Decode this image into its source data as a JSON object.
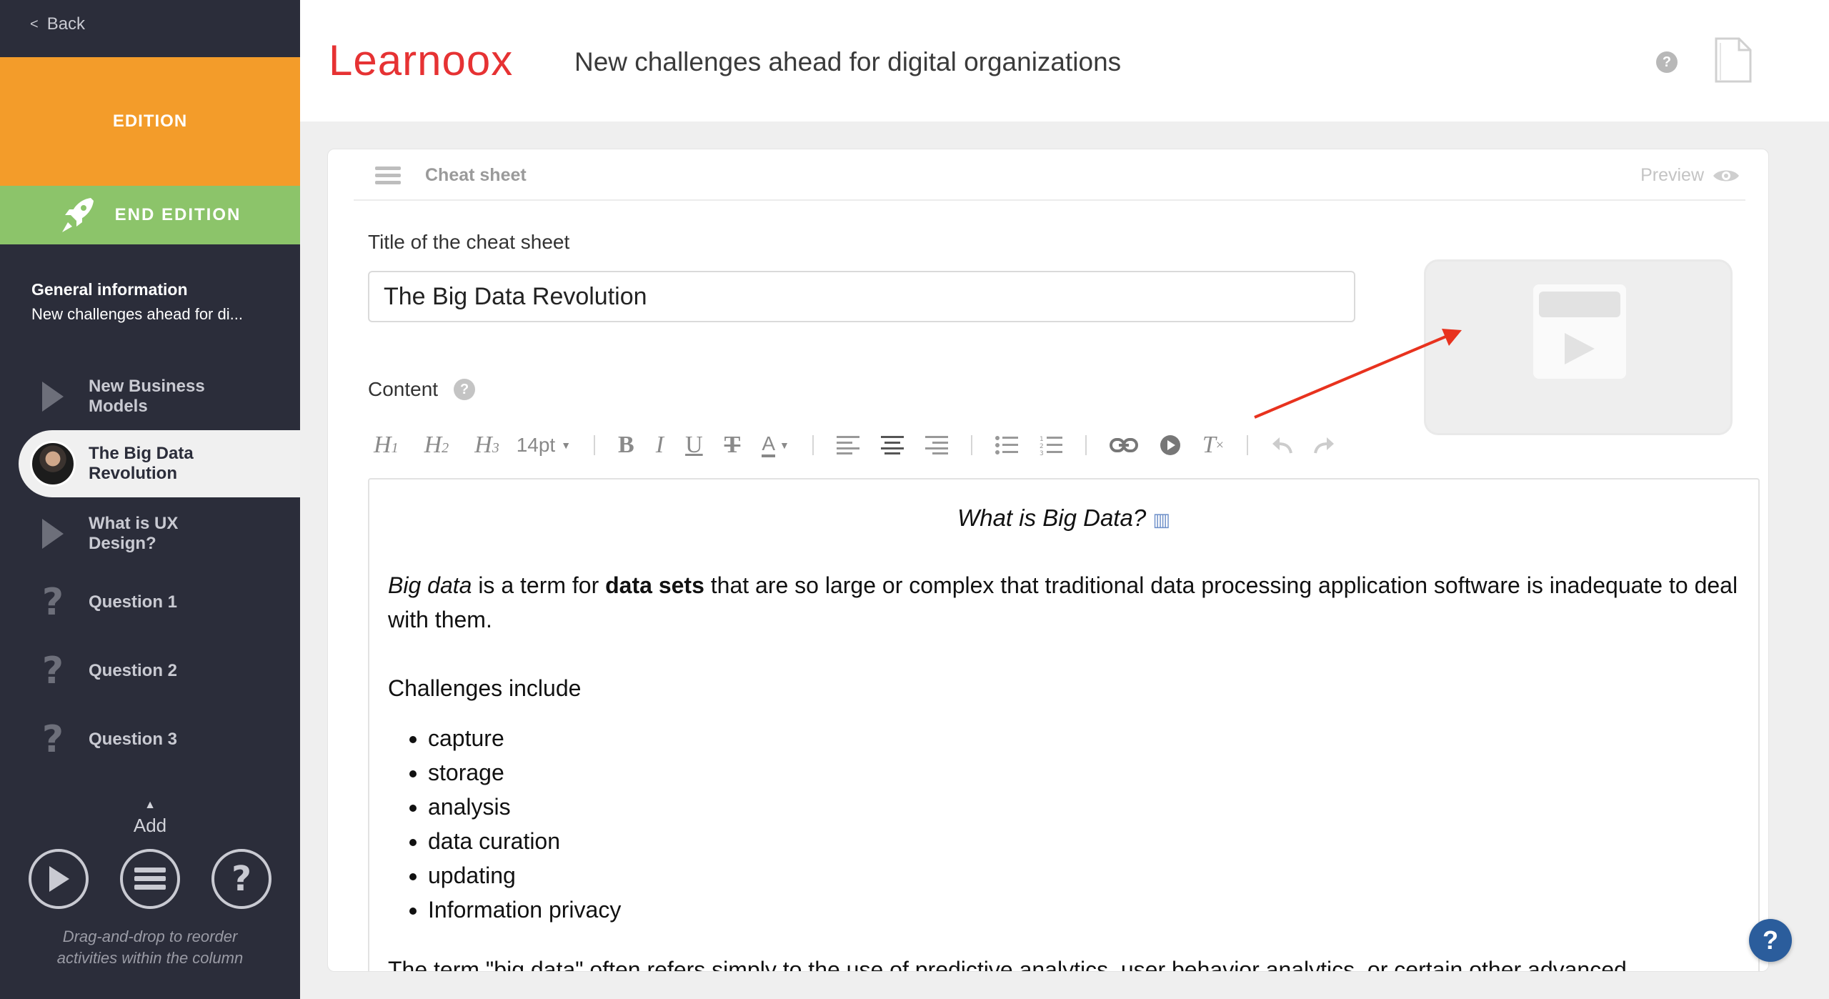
{
  "sidebar": {
    "back_label": "Back",
    "edition_label": "EDITION",
    "end_edition_label": "END EDITION",
    "general_info": {
      "title": "General information",
      "subtitle": "New challenges ahead for di..."
    },
    "activities": [
      {
        "label": "New Business\nModels",
        "icon": "play-icon",
        "active": false
      },
      {
        "label": "The Big Data\nRevolution",
        "icon": "avatar",
        "active": true
      },
      {
        "label": "What is UX\nDesign?",
        "icon": "play-icon",
        "active": false
      },
      {
        "label": "Question 1",
        "icon": "question-icon",
        "active": false
      },
      {
        "label": "Question 2",
        "icon": "question-icon",
        "active": false
      },
      {
        "label": "Question 3",
        "icon": "question-icon",
        "active": false
      }
    ],
    "add_label": "Add",
    "add_buttons": [
      "play-icon",
      "list-icon",
      "question-icon"
    ],
    "drag_hint": "Drag-and-drop to reorder\nactivities within the column"
  },
  "header": {
    "logo": "Learnoox",
    "title": "New challenges ahead for digital organizations"
  },
  "card": {
    "title": "Cheat sheet",
    "preview_label": "Preview",
    "title_field_label": "Title of the cheat sheet",
    "title_value": "The Big Data Revolution",
    "content_label": "Content"
  },
  "toolbar": {
    "headings": [
      "H1",
      "H2",
      "H3"
    ],
    "font_size": "14pt",
    "font_color": "A"
  },
  "editor": {
    "heading": "What is Big Data?",
    "para1_term": "Big data",
    "para1_a": " is a term for ",
    "para1_bold": "data sets",
    "para1_b": " that are so large or complex that traditional data processing application software is inadequate to deal with them.",
    "challenges": "Challenges include",
    "list": [
      "capture",
      "storage",
      "analysis",
      "data curation",
      "updating",
      "Information privacy"
    ],
    "more": "The term \"big data\" often refers simply to the use of predictive analytics, user behavior analytics, or certain other advanced"
  },
  "colors": {
    "sidebar_bg": "#2b2d3a",
    "edition": "#f39c2a",
    "end_edition": "#8cc46a",
    "brand": "#e63233",
    "annotation_arrow": "#e8321e",
    "help_fab": "#2b5d9c"
  }
}
